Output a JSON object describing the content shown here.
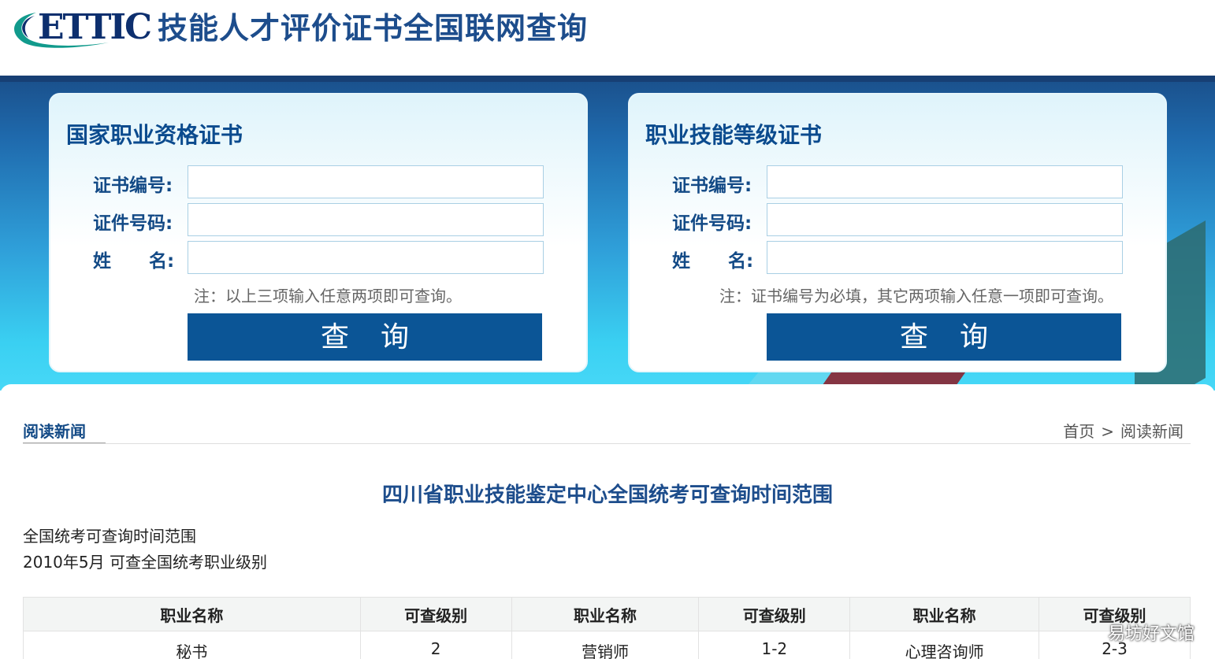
{
  "header": {
    "logo_text": "ETTIC",
    "site_title": "技能人才评价证书全国联网查询"
  },
  "cards": [
    {
      "title": "国家职业资格证书",
      "fields": [
        {
          "label": "证书编号:",
          "value": ""
        },
        {
          "label": "证件号码:",
          "value": ""
        },
        {
          "label": "姓 名:",
          "value": ""
        }
      ],
      "note": "注：以上三项输入任意两项即可查询。",
      "button": "查询"
    },
    {
      "title": "职业技能等级证书",
      "fields": [
        {
          "label": "证书编号:",
          "value": ""
        },
        {
          "label": "证件号码:",
          "value": ""
        },
        {
          "label": "姓 名:",
          "value": ""
        }
      ],
      "note": "注：证书编号为必填，其它两项输入任意一项即可查询。",
      "button": "查询"
    }
  ],
  "section": {
    "tab": "阅读新闻",
    "breadcrumb": [
      "首页",
      ">",
      "阅读新闻"
    ]
  },
  "article": {
    "title": "四川省职业技能鉴定中心全国统考可查询时间范围",
    "lines": [
      "全国统考可查询时间范围",
      "2010年5月 可查全国统考职业级别"
    ]
  },
  "table": {
    "headers": [
      "职业名称",
      "可查级别",
      "职业名称",
      "可查级别",
      "职业名称",
      "可查级别"
    ],
    "rows": [
      [
        "秘书",
        "2",
        "营销师",
        "1-2",
        "心理咨询师",
        "2-3"
      ]
    ]
  },
  "watermark": "易坊好文馆",
  "colors": {
    "brand_blue": "#0b5596",
    "title_blue": "#1d4d8c"
  }
}
